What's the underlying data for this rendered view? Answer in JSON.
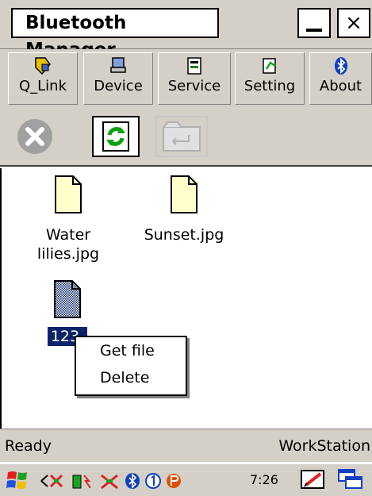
{
  "window": {
    "title": "Bluetooth Manager",
    "close_label": "×"
  },
  "menu": {
    "items": [
      {
        "label": "Q_Link",
        "icon": "q-link-icon"
      },
      {
        "label": "Device",
        "icon": "device-icon"
      },
      {
        "label": "Service",
        "icon": "service-icon"
      },
      {
        "label": "Setting",
        "icon": "setting-icon"
      },
      {
        "label": "About",
        "icon": "bluetooth-icon"
      }
    ]
  },
  "toolbar": {
    "buttons": [
      {
        "icon": "cancel-icon",
        "enabled": true
      },
      {
        "icon": "refresh-icon",
        "enabled": true
      },
      {
        "icon": "folder-back-icon",
        "enabled": false
      }
    ]
  },
  "files": [
    {
      "name": "Water\nlilies.jpg",
      "selected": false
    },
    {
      "name": "Sunset.jpg",
      "selected": false
    },
    {
      "name": "123.",
      "selected": true
    }
  ],
  "context_menu": {
    "items": [
      "Get file",
      "Delete"
    ]
  },
  "status": {
    "left": "Ready",
    "right": "WorkStation"
  },
  "taskbar": {
    "time": "7:26 PM"
  },
  "colors": {
    "chrome": "#d4d0c8",
    "selection": "#0a246a",
    "file_icon_fill": "#ffffcc"
  }
}
